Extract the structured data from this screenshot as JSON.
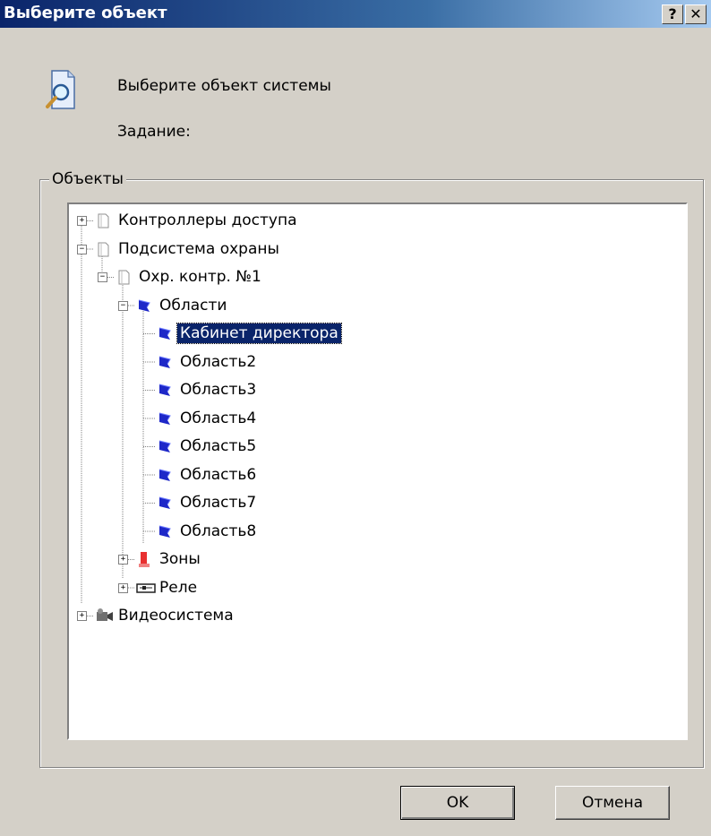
{
  "window": {
    "title": "Выберите объект",
    "help_label": "?",
    "close_label": "✕"
  },
  "header": {
    "prompt": "Выберите объект системы",
    "task_label": "Задание:"
  },
  "group": {
    "legend": "Объекты"
  },
  "tree": {
    "nodes": [
      {
        "id": "n0",
        "label": "Контроллеры доступа",
        "icon": "controller-icon",
        "expander": "+"
      },
      {
        "id": "n1",
        "label": "Подсистема охраны",
        "icon": "controller-icon",
        "expander": "−"
      },
      {
        "id": "n2",
        "label": "Охр. контр. №1",
        "icon": "controller-icon",
        "expander": "−"
      },
      {
        "id": "n3",
        "label": "Области",
        "icon": "area-flag-icon",
        "expander": "−"
      },
      {
        "id": "n4",
        "label": "Кабинет директора",
        "icon": "area-flag-icon",
        "selected": true
      },
      {
        "id": "n5",
        "label": "Область2",
        "icon": "area-flag-icon"
      },
      {
        "id": "n6",
        "label": "Область3",
        "icon": "area-flag-icon"
      },
      {
        "id": "n7",
        "label": "Область4",
        "icon": "area-flag-icon"
      },
      {
        "id": "n8",
        "label": "Область5",
        "icon": "area-flag-icon"
      },
      {
        "id": "n9",
        "label": "Область6",
        "icon": "area-flag-icon"
      },
      {
        "id": "n10",
        "label": "Область7",
        "icon": "area-flag-icon"
      },
      {
        "id": "n11",
        "label": "Область8",
        "icon": "area-flag-icon"
      },
      {
        "id": "n12",
        "label": "Зоны",
        "icon": "zone-icon",
        "expander": "+"
      },
      {
        "id": "n13",
        "label": "Реле",
        "icon": "relay-icon",
        "expander": "+"
      },
      {
        "id": "n14",
        "label": "Видеосистема",
        "icon": "camera-icon",
        "expander": "+"
      }
    ]
  },
  "buttons": {
    "ok_label": "OK",
    "cancel_label": "Отмена"
  },
  "colors": {
    "title_bar": "#0a246a",
    "selection": "#0a246a",
    "dialog_bg": "#d4d0c8",
    "area_flag": "#1e28c8"
  }
}
